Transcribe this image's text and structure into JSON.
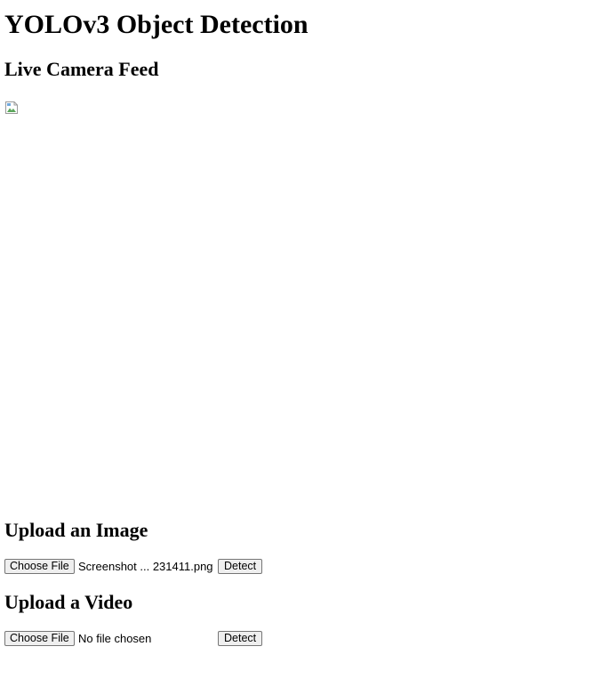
{
  "page": {
    "title": "YOLOv3 Object Detection"
  },
  "camera_feed": {
    "heading": "Live Camera Feed",
    "image_state": "broken-image-icon"
  },
  "upload_image": {
    "heading": "Upload an Image",
    "choose_file_label": "Choose File",
    "file_name": "Screenshot ... 231411.png",
    "detect_label": "Detect"
  },
  "upload_video": {
    "heading": "Upload a Video",
    "choose_file_label": "Choose File",
    "file_name": "No file chosen",
    "detect_label": "Detect"
  }
}
